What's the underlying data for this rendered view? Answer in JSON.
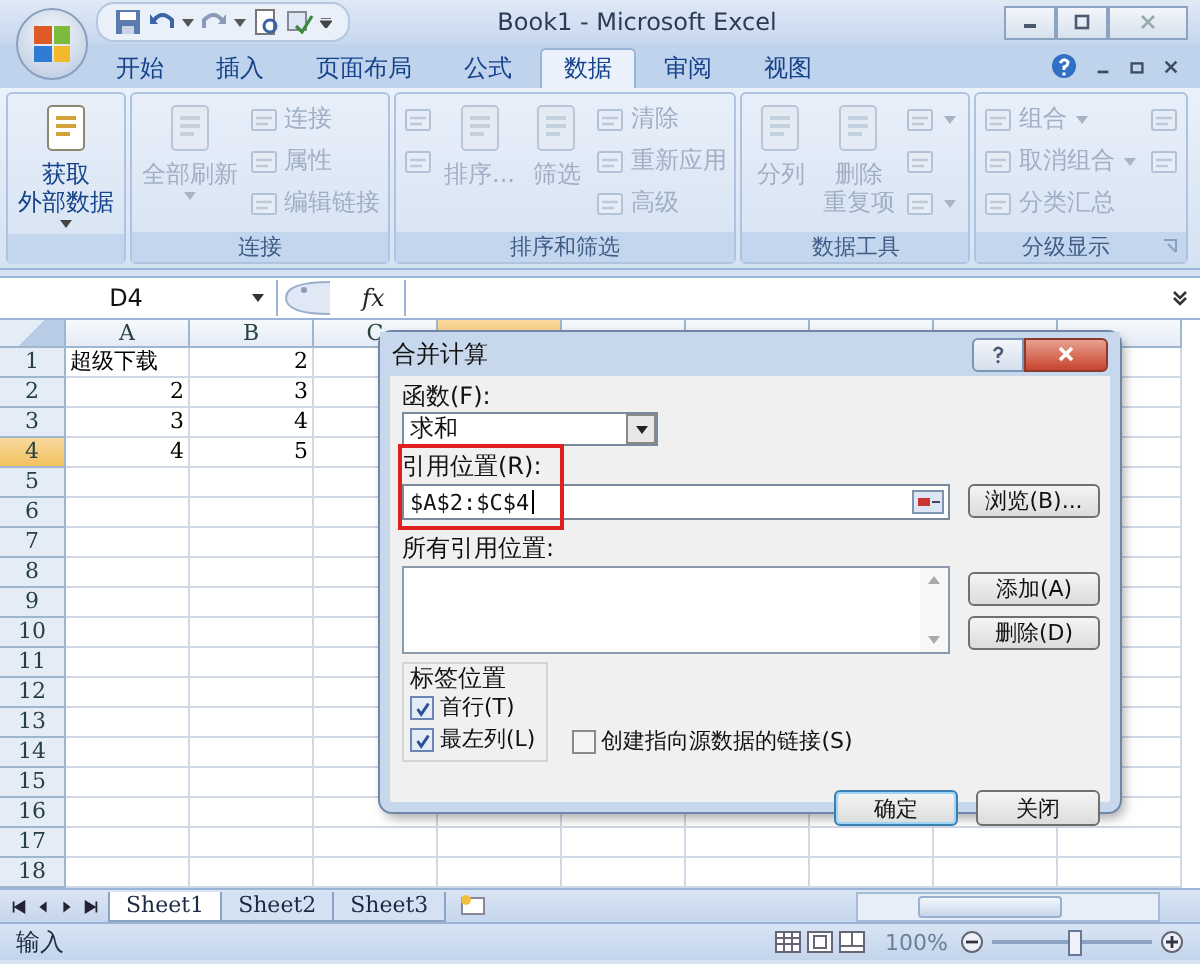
{
  "window": {
    "title": "Book1 - Microsoft Excel"
  },
  "tabs": [
    {
      "label": "开始",
      "selected": false
    },
    {
      "label": "插入",
      "selected": false
    },
    {
      "label": "页面布局",
      "selected": false
    },
    {
      "label": "公式",
      "selected": false
    },
    {
      "label": "数据",
      "selected": true
    },
    {
      "label": "审阅",
      "selected": false
    },
    {
      "label": "视图",
      "selected": false
    }
  ],
  "ribbon": {
    "groups": [
      {
        "columns": [
          {
            "kind": "large",
            "lines": [
              "获取",
              "外部数据"
            ],
            "dropdown": true,
            "disabled": false
          }
        ]
      },
      {
        "label": "连接",
        "launcher": false,
        "columns": [
          {
            "kind": "large",
            "lines": [
              "全部刷新"
            ],
            "dropdown": true,
            "disabled": true
          },
          {
            "kind": "stack",
            "items": [
              {
                "label": "连接",
                "disabled": true
              },
              {
                "label": "属性",
                "disabled": true
              },
              {
                "label": "编辑链接",
                "disabled": true
              }
            ]
          }
        ]
      },
      {
        "label": "排序和筛选",
        "launcher": false,
        "columns": [
          {
            "kind": "stack",
            "items": [
              {
                "disabled": true
              },
              {
                "disabled": true
              }
            ]
          },
          {
            "kind": "large",
            "lines": [
              "排序..."
            ],
            "dropdown": false,
            "disabled": true
          },
          {
            "kind": "large",
            "lines": [
              "筛选"
            ],
            "dropdown": false,
            "disabled": true
          },
          {
            "kind": "stack",
            "items": [
              {
                "label": "清除",
                "disabled": true
              },
              {
                "label": "重新应用",
                "disabled": true
              },
              {
                "label": "高级",
                "disabled": true
              }
            ]
          }
        ]
      },
      {
        "label": "数据工具",
        "launcher": false,
        "columns": [
          {
            "kind": "large",
            "lines": [
              "分列"
            ],
            "dropdown": false,
            "disabled": true
          },
          {
            "kind": "large",
            "lines": [
              "删除",
              "重复项"
            ],
            "dropdown": false,
            "disabled": true
          },
          {
            "kind": "stack",
            "items": [
              {
                "disabled": true,
                "dropdown": true
              },
              {
                "disabled": true
              },
              {
                "disabled": true,
                "dropdown": true
              }
            ]
          }
        ]
      },
      {
        "label": "分级显示",
        "launcher": true,
        "columns": [
          {
            "kind": "stack",
            "items": [
              {
                "label": "组合",
                "disabled": true,
                "dropdown": true
              },
              {
                "label": "取消组合",
                "disabled": true,
                "dropdown": true
              },
              {
                "label": "分类汇总",
                "disabled": true
              }
            ]
          },
          {
            "kind": "stack",
            "items": [
              {
                "disabled": true
              },
              {
                "disabled": true
              }
            ]
          }
        ]
      }
    ]
  },
  "formula_bar": {
    "name_box": "D4",
    "function_label": "fx"
  },
  "sheet": {
    "columns": [
      {
        "label": "A",
        "selected": false
      },
      {
        "label": "B",
        "selected": false
      },
      {
        "label": "C",
        "selected": false
      }
    ],
    "extra_columns": [
      {
        "selected": true
      },
      {
        "selected": false
      },
      {
        "selected": false
      },
      {
        "selected": false
      },
      {
        "selected": false
      },
      {
        "selected": false
      }
    ],
    "rows": [
      {
        "label": "1",
        "selected": false,
        "cells": [
          {
            "text": "超级下载",
            "kind": "text"
          },
          {
            "text": "2",
            "kind": "number"
          }
        ]
      },
      {
        "label": "2",
        "selected": false,
        "cells": [
          {
            "text": "2",
            "kind": "number"
          },
          {
            "text": "3",
            "kind": "number"
          }
        ]
      },
      {
        "label": "3",
        "selected": false,
        "cells": [
          {
            "text": "3",
            "kind": "number"
          },
          {
            "text": "4",
            "kind": "number"
          }
        ]
      },
      {
        "label": "4",
        "selected": true,
        "cells": [
          {
            "text": "4",
            "kind": "number"
          },
          {
            "text": "5",
            "kind": "number"
          }
        ]
      },
      {
        "label": "5",
        "selected": false,
        "cells": []
      },
      {
        "label": "6",
        "selected": false,
        "cells": []
      },
      {
        "label": "7",
        "selected": false,
        "cells": []
      },
      {
        "label": "8",
        "selected": false,
        "cells": []
      },
      {
        "label": "9",
        "selected": false,
        "cells": []
      },
      {
        "label": "10",
        "selected": false,
        "cells": []
      },
      {
        "label": "11",
        "selected": false,
        "cells": []
      },
      {
        "label": "12",
        "selected": false,
        "cells": []
      },
      {
        "label": "13",
        "selected": false,
        "cells": []
      },
      {
        "label": "14",
        "selected": false,
        "cells": []
      },
      {
        "label": "15",
        "selected": false,
        "cells": []
      },
      {
        "label": "16",
        "selected": false,
        "cells": []
      },
      {
        "label": "17",
        "selected": false,
        "cells": []
      },
      {
        "label": "18",
        "selected": false,
        "cells": []
      }
    ]
  },
  "dialog": {
    "title": "合并计算",
    "function_label": "函数(F):",
    "function_value": "求和",
    "reference_label": "引用位置(R):",
    "reference_value": "$A$2:$C$4",
    "browse_button": "浏览(B)...",
    "all_references_label": "所有引用位置:",
    "add_button": "添加(A)",
    "delete_button": "删除(D)",
    "labels_group": "标签位置",
    "options": [
      {
        "label": "首行(T)",
        "checked": true
      },
      {
        "label": "最左列(L)",
        "checked": true
      }
    ],
    "link_option": {
      "label": "创建指向源数据的链接(S)",
      "checked": false
    },
    "ok_button": "确定",
    "close_button": "关闭"
  },
  "sheet_tabs": [
    {
      "label": "Sheet1",
      "selected": true
    },
    {
      "label": "Sheet2",
      "selected": false
    },
    {
      "label": "Sheet3",
      "selected": false
    }
  ],
  "status_bar": {
    "mode": "输入",
    "zoom": "100%",
    "zoom_slider": {
      "level": 0.5
    }
  }
}
